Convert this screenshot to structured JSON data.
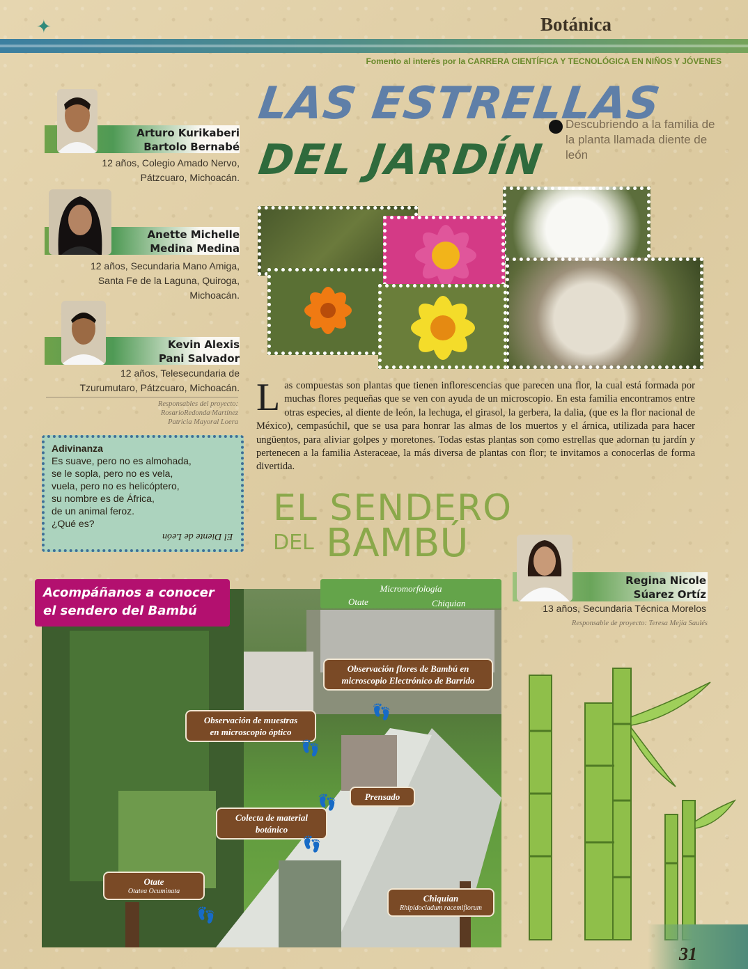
{
  "header": {
    "section": "Botánica",
    "tagline": "Fomento al interés por la CARRERA CIENTÍFICA Y TECNOLÓGICA EN NIÑOS Y JÓVENES"
  },
  "title": {
    "line1": "LAS ESTRELLAS",
    "line2": "DEL JARDÍN",
    "subtitle": "Descubriendo a la familia de la planta llamada diente de león"
  },
  "authors": [
    {
      "name1": "Arturo Kurikaberi",
      "name2": "Bartolo Bernabé",
      "info1": "12 años, Colegio Amado Nervo,",
      "info2": "Pátzcuaro, Michoacán.",
      "info3": ""
    },
    {
      "name1": "Anette Michelle",
      "name2": "Medina Medina",
      "info1": "12 años, Secundaria Mano Amiga,",
      "info2": "Santa Fe de la Laguna, Quiroga,",
      "info3": "Michoacán."
    },
    {
      "name1": "Kevin Alexis",
      "name2": "Pani Salvador",
      "info1": "12 años, Telesecundaria de",
      "info2": "Tzurumutaro, Pátzcuaro, Michoacán.",
      "info3": ""
    }
  ],
  "responsables": {
    "label": "Responsables del proyecto:",
    "p1": "RosarioRedonda Martínez",
    "p2": "Patricia Mayoral Loera"
  },
  "riddle": {
    "heading": "Adivinanza",
    "lines": [
      "Es suave, pero no es almohada,",
      "se le sopla, pero no es vela,",
      "vuela, pero no es helicóptero,",
      "su nombre es de África,",
      "de un animal feroz.",
      "¿Qué es?"
    ],
    "answer": "El Diente de León"
  },
  "article": {
    "dropcap": "L",
    "text": "as compuestas son plantas que tienen inflorescencias que parecen una flor, la cual está formada por muchas flores pequeñas que se ven con ayuda de un microscopio. En esta familia encontramos entre otras especies, al diente de león, la lechuga, el girasol, la gerbera, la dalia, (que es la flor nacional de México), cempasúchil, que se usa para honrar las almas de los muertos y el árnica, utilizada para hacer ungüentos, para aliviar golpes y moretones. Todas estas plantas son como estrellas que adornan tu jardín y pertenecen a la familia Asteraceae, la más diversa de plantas con flor; te invitamos a conocerlas de forma divertida."
  },
  "sendero": {
    "line1": "EL SENDERO",
    "del": "DEL",
    "bambu": "BAMBÚ"
  },
  "regina": {
    "name1": "Regina Nicole",
    "name2": "Súarez Ortíz",
    "info": "13 años, Secundaria Técnica Morelos",
    "resp": "Responsable de proyecto: Teresa Mejía Saulés"
  },
  "photo": {
    "banner1": "Acompáñanos a conocer",
    "banner2": "el sendero del Bambú",
    "micro_title": "Micromorfología",
    "micro_a": "Otate",
    "micro_b": "Chiquian",
    "lbl_sem1": "Observación flores de Bambú en",
    "lbl_sem2": "microscopio Electrónico de Barrido",
    "lbl_opt1": "Observación de muestras",
    "lbl_opt2": "en microscopio óptico",
    "lbl_prensado": "Prensado",
    "lbl_colecta1": "Colecta de material",
    "lbl_colecta2": "botánico",
    "lbl_otate": "Otate",
    "lbl_otate_sci": "Otatea Ocuminata",
    "lbl_chiquian": "Chiquian",
    "lbl_chiquian_sci": "Rhipidocladum racemiflorum"
  },
  "page_number": "31"
}
